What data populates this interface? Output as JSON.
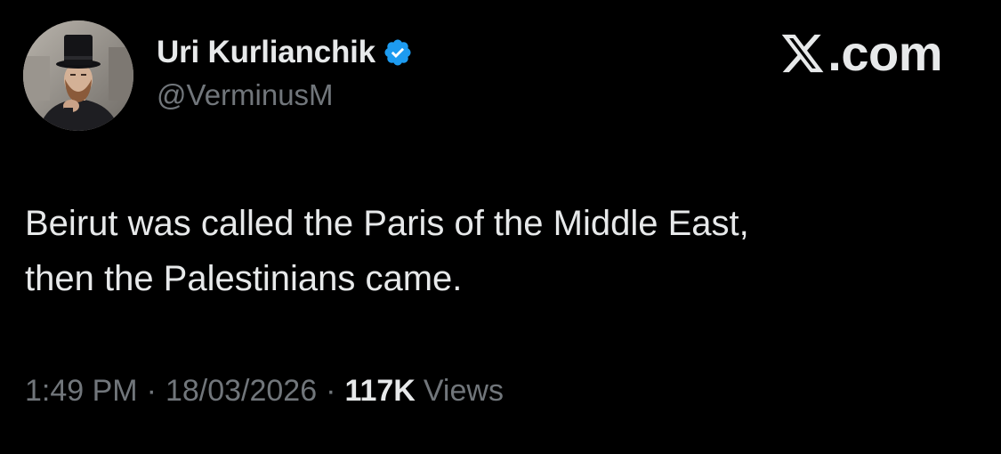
{
  "author": {
    "display_name": "Uri Kurlianchik",
    "handle": "@VerminusM",
    "verified": true,
    "avatar_icon": "profile-photo-top-hat-man"
  },
  "brand": {
    "icon": "x-logo-icon",
    "text": ".com"
  },
  "tweet": {
    "text": "Beirut was called the Paris of the Middle East,\nthen the Palestinians came."
  },
  "meta": {
    "time": "1:49 PM",
    "separator": "·",
    "date": "18/03/2026",
    "views_count": "117K",
    "views_label": "Views"
  },
  "colors": {
    "background": "#000000",
    "primary_text": "#e7e9ea",
    "secondary_text": "#71767b",
    "verified_blue": "#1d9bf0"
  }
}
